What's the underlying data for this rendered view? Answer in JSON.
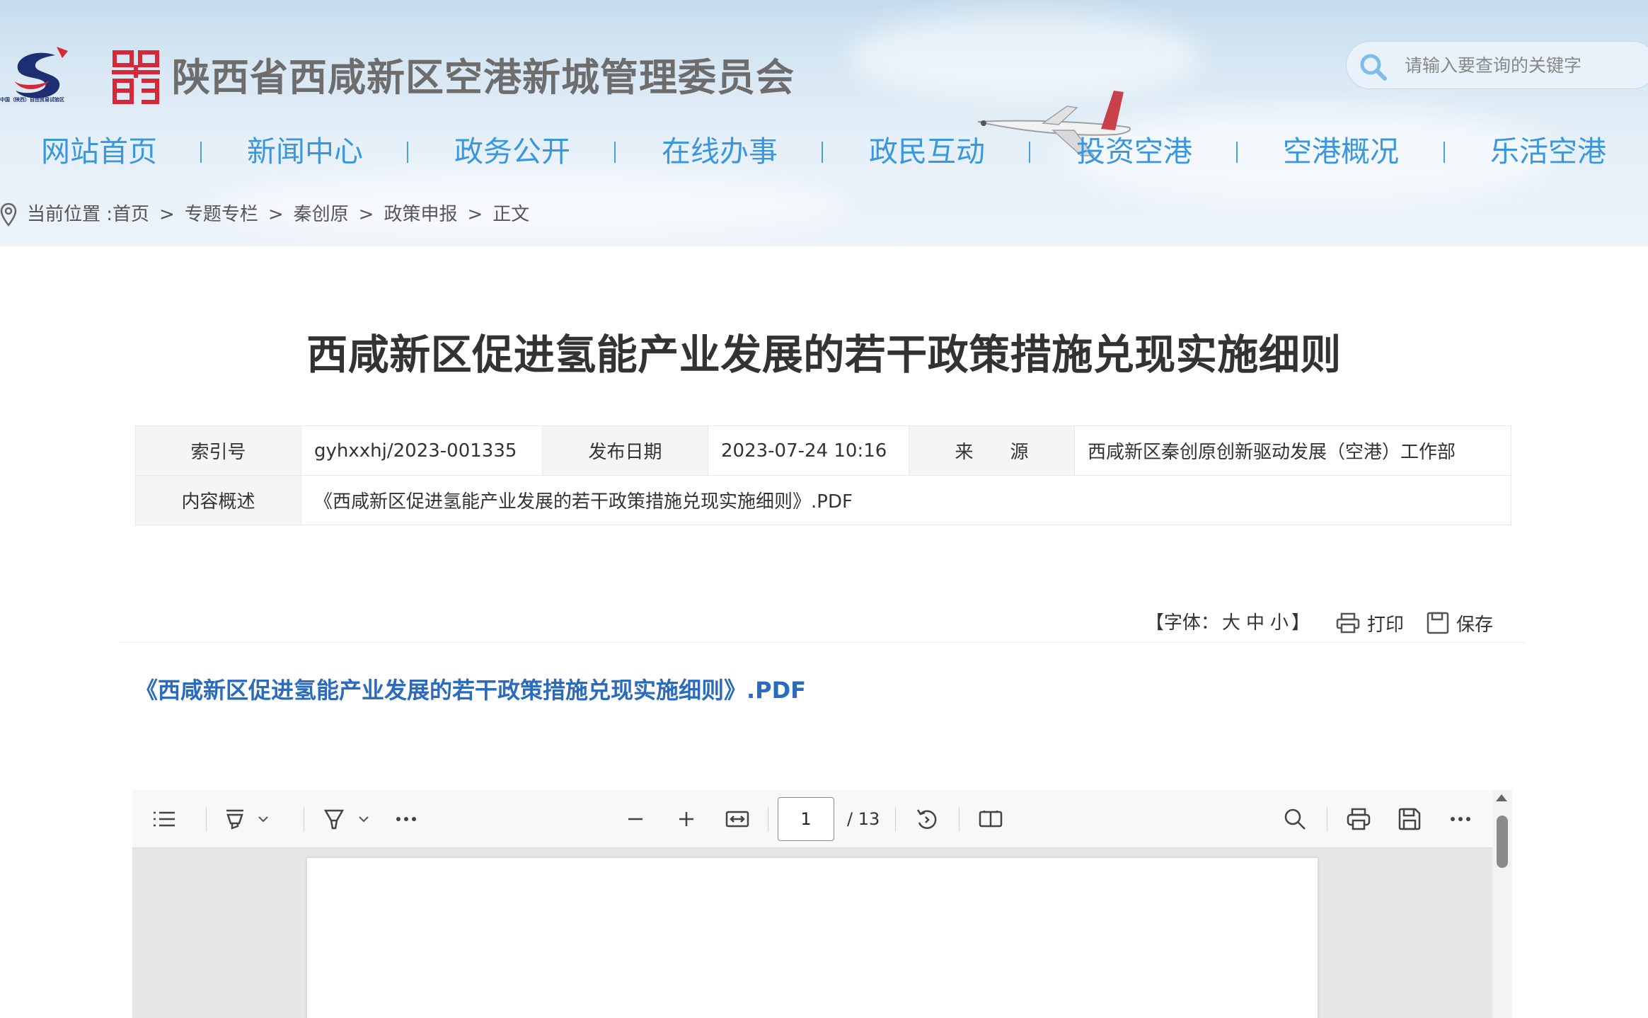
{
  "header": {
    "logo_caption": "中国（陕西）自由贸易试验区",
    "site_title": "陕西省西咸新区空港新城管理委员会",
    "search": {
      "placeholder": "请输入要查询的关键字"
    },
    "nav": [
      {
        "label": "网站首页"
      },
      {
        "label": "新闻中心"
      },
      {
        "label": "政务公开"
      },
      {
        "label": "在线办事"
      },
      {
        "label": "政民互动"
      },
      {
        "label": "投资空港"
      },
      {
        "label": "空港概况"
      },
      {
        "label": "乐活空港"
      }
    ],
    "breadcrumb": {
      "prefix": "当前位置 : ",
      "items": [
        "首页",
        "专题专栏",
        "秦创原",
        "政策申报",
        "正文"
      ],
      "separator": ">"
    }
  },
  "article": {
    "title": "西咸新区促进氢能产业发展的若干政策措施兑现实施细则",
    "meta": {
      "index_label": "索引号",
      "index_value": "gyhxxhj/2023-001335",
      "date_label": "发布日期",
      "date_value": "2023-07-24 10:16",
      "source_label": "来　　源",
      "source_value": "西咸新区秦创原创新驱动发展（空港）工作部",
      "summary_label": "内容概述",
      "summary_value": "《西咸新区促进氢能产业发展的若干政策措施兑现实施细则》.PDF"
    },
    "toolbar": {
      "font_prefix": "【字体：",
      "font_large": "大",
      "font_medium": "中",
      "font_small": "小",
      "font_suffix": "】",
      "print_label": "打印",
      "save_label": "保存"
    },
    "attachment_link": "《西咸新区促进氢能产业发展的若干政策措施兑现实施细则》.PDF"
  },
  "pdf_viewer": {
    "current_page": "1",
    "total_pages": "/ 13"
  },
  "colors": {
    "nav_text": "#3a97dd",
    "link": "#2a6bbd",
    "seal_red": "#d7283a"
  }
}
